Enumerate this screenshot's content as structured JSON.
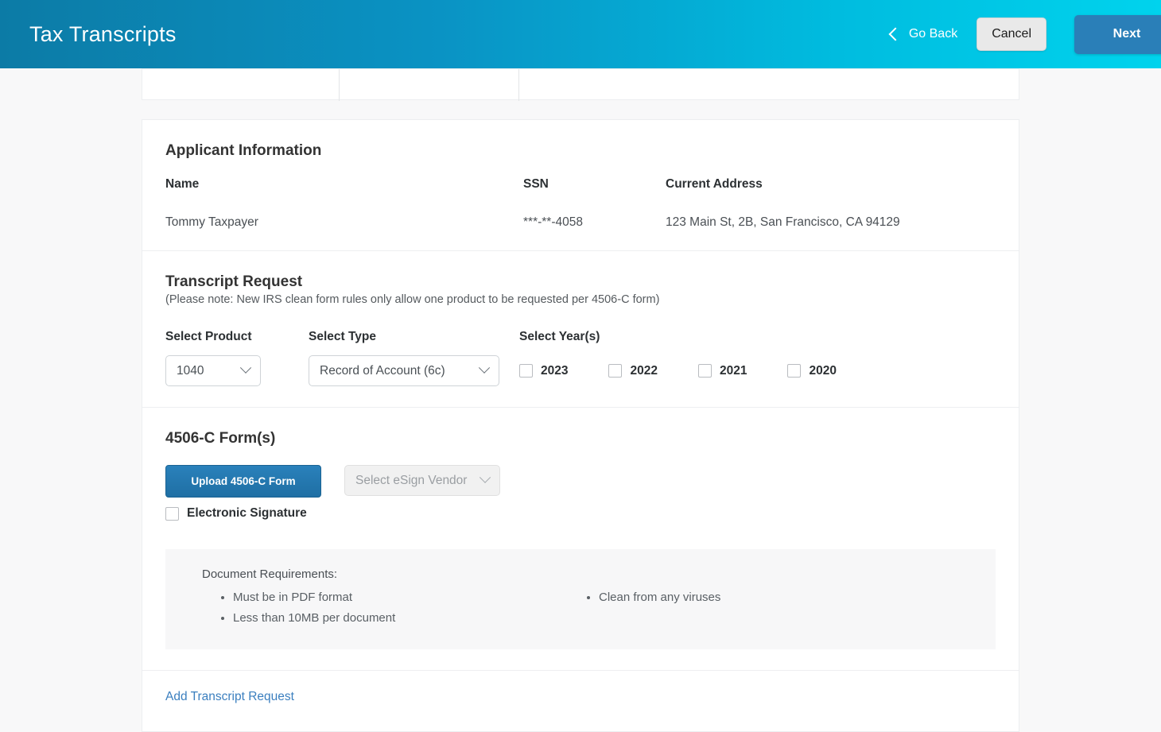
{
  "header": {
    "title": "Tax Transcripts",
    "go_back_label": "Go Back",
    "cancel_label": "Cancel",
    "next_label": "Next",
    "gradient_start_color": "#0c7ba6",
    "gradient_end_color": "#00d3ed",
    "next_button_color": "#2a7fb8"
  },
  "applicant": {
    "section_title": "Applicant Information",
    "labels": {
      "name": "Name",
      "ssn": "SSN",
      "address": "Current Address"
    },
    "values": {
      "name": "Tommy Taxpayer",
      "ssn": "***-**-4058",
      "address": "123 Main St, 2B, San Francisco, CA 94129"
    }
  },
  "transcript_request": {
    "section_title": "Transcript Request",
    "note": "(Please note: New IRS clean form rules only allow one product to be requested per 4506-C form)",
    "product": {
      "label": "Select Product",
      "value": "1040"
    },
    "type": {
      "label": "Select Type",
      "value": "Record of Account (6c)"
    },
    "years": {
      "label": "Select Year(s)",
      "options": [
        {
          "label": "2023",
          "checked": false
        },
        {
          "label": "2022",
          "checked": false
        },
        {
          "label": "2021",
          "checked": false
        },
        {
          "label": "2020",
          "checked": false
        }
      ]
    }
  },
  "form_4506c": {
    "section_title": "4506-C Form(s)",
    "upload_button_label": "Upload 4506-C Form",
    "esign_vendor_placeholder": "Select eSign Vendor",
    "electronic_signature_label": "Electronic Signature",
    "upload_button_color": "#2275ad",
    "requirements": {
      "title": "Document Requirements:",
      "column_left": [
        "Must be in PDF format",
        "Less than 10MB per document"
      ],
      "column_right": [
        "Clean from any viruses"
      ]
    }
  },
  "footer": {
    "add_request_label": "Add Transcript Request",
    "link_color": "#3b7fbf"
  }
}
